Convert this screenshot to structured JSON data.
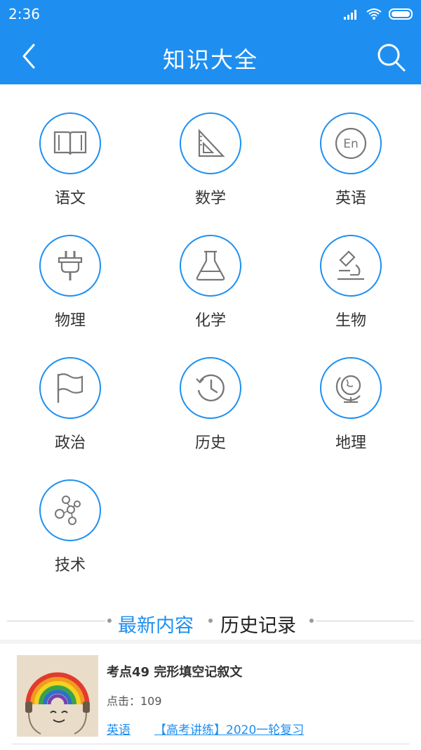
{
  "status_bar": {
    "time": "2:36"
  },
  "header": {
    "title": "知识大全"
  },
  "categories": [
    {
      "label": "语文",
      "icon": "book-icon"
    },
    {
      "label": "数学",
      "icon": "set-square-icon"
    },
    {
      "label": "英语",
      "icon": "english-icon",
      "glyph": "En"
    },
    {
      "label": "物理",
      "icon": "plug-icon"
    },
    {
      "label": "化学",
      "icon": "flask-icon"
    },
    {
      "label": "生物",
      "icon": "microscope-icon"
    },
    {
      "label": "政治",
      "icon": "flag-icon"
    },
    {
      "label": "历史",
      "icon": "history-clock-icon"
    },
    {
      "label": "地理",
      "icon": "globe-icon"
    },
    {
      "label": "技术",
      "icon": "molecule-icon"
    }
  ],
  "section": {
    "tab_latest": "最新内容",
    "tab_history": "历史记录"
  },
  "article": {
    "title": "考点49 完形填空记叙文",
    "clicks": "点击：109",
    "tag": "英语",
    "series": "【高考讲练】2020一轮复习"
  },
  "colors": {
    "accent": "#1e8ff0",
    "icon_gray": "#777777",
    "text": "#333333"
  }
}
